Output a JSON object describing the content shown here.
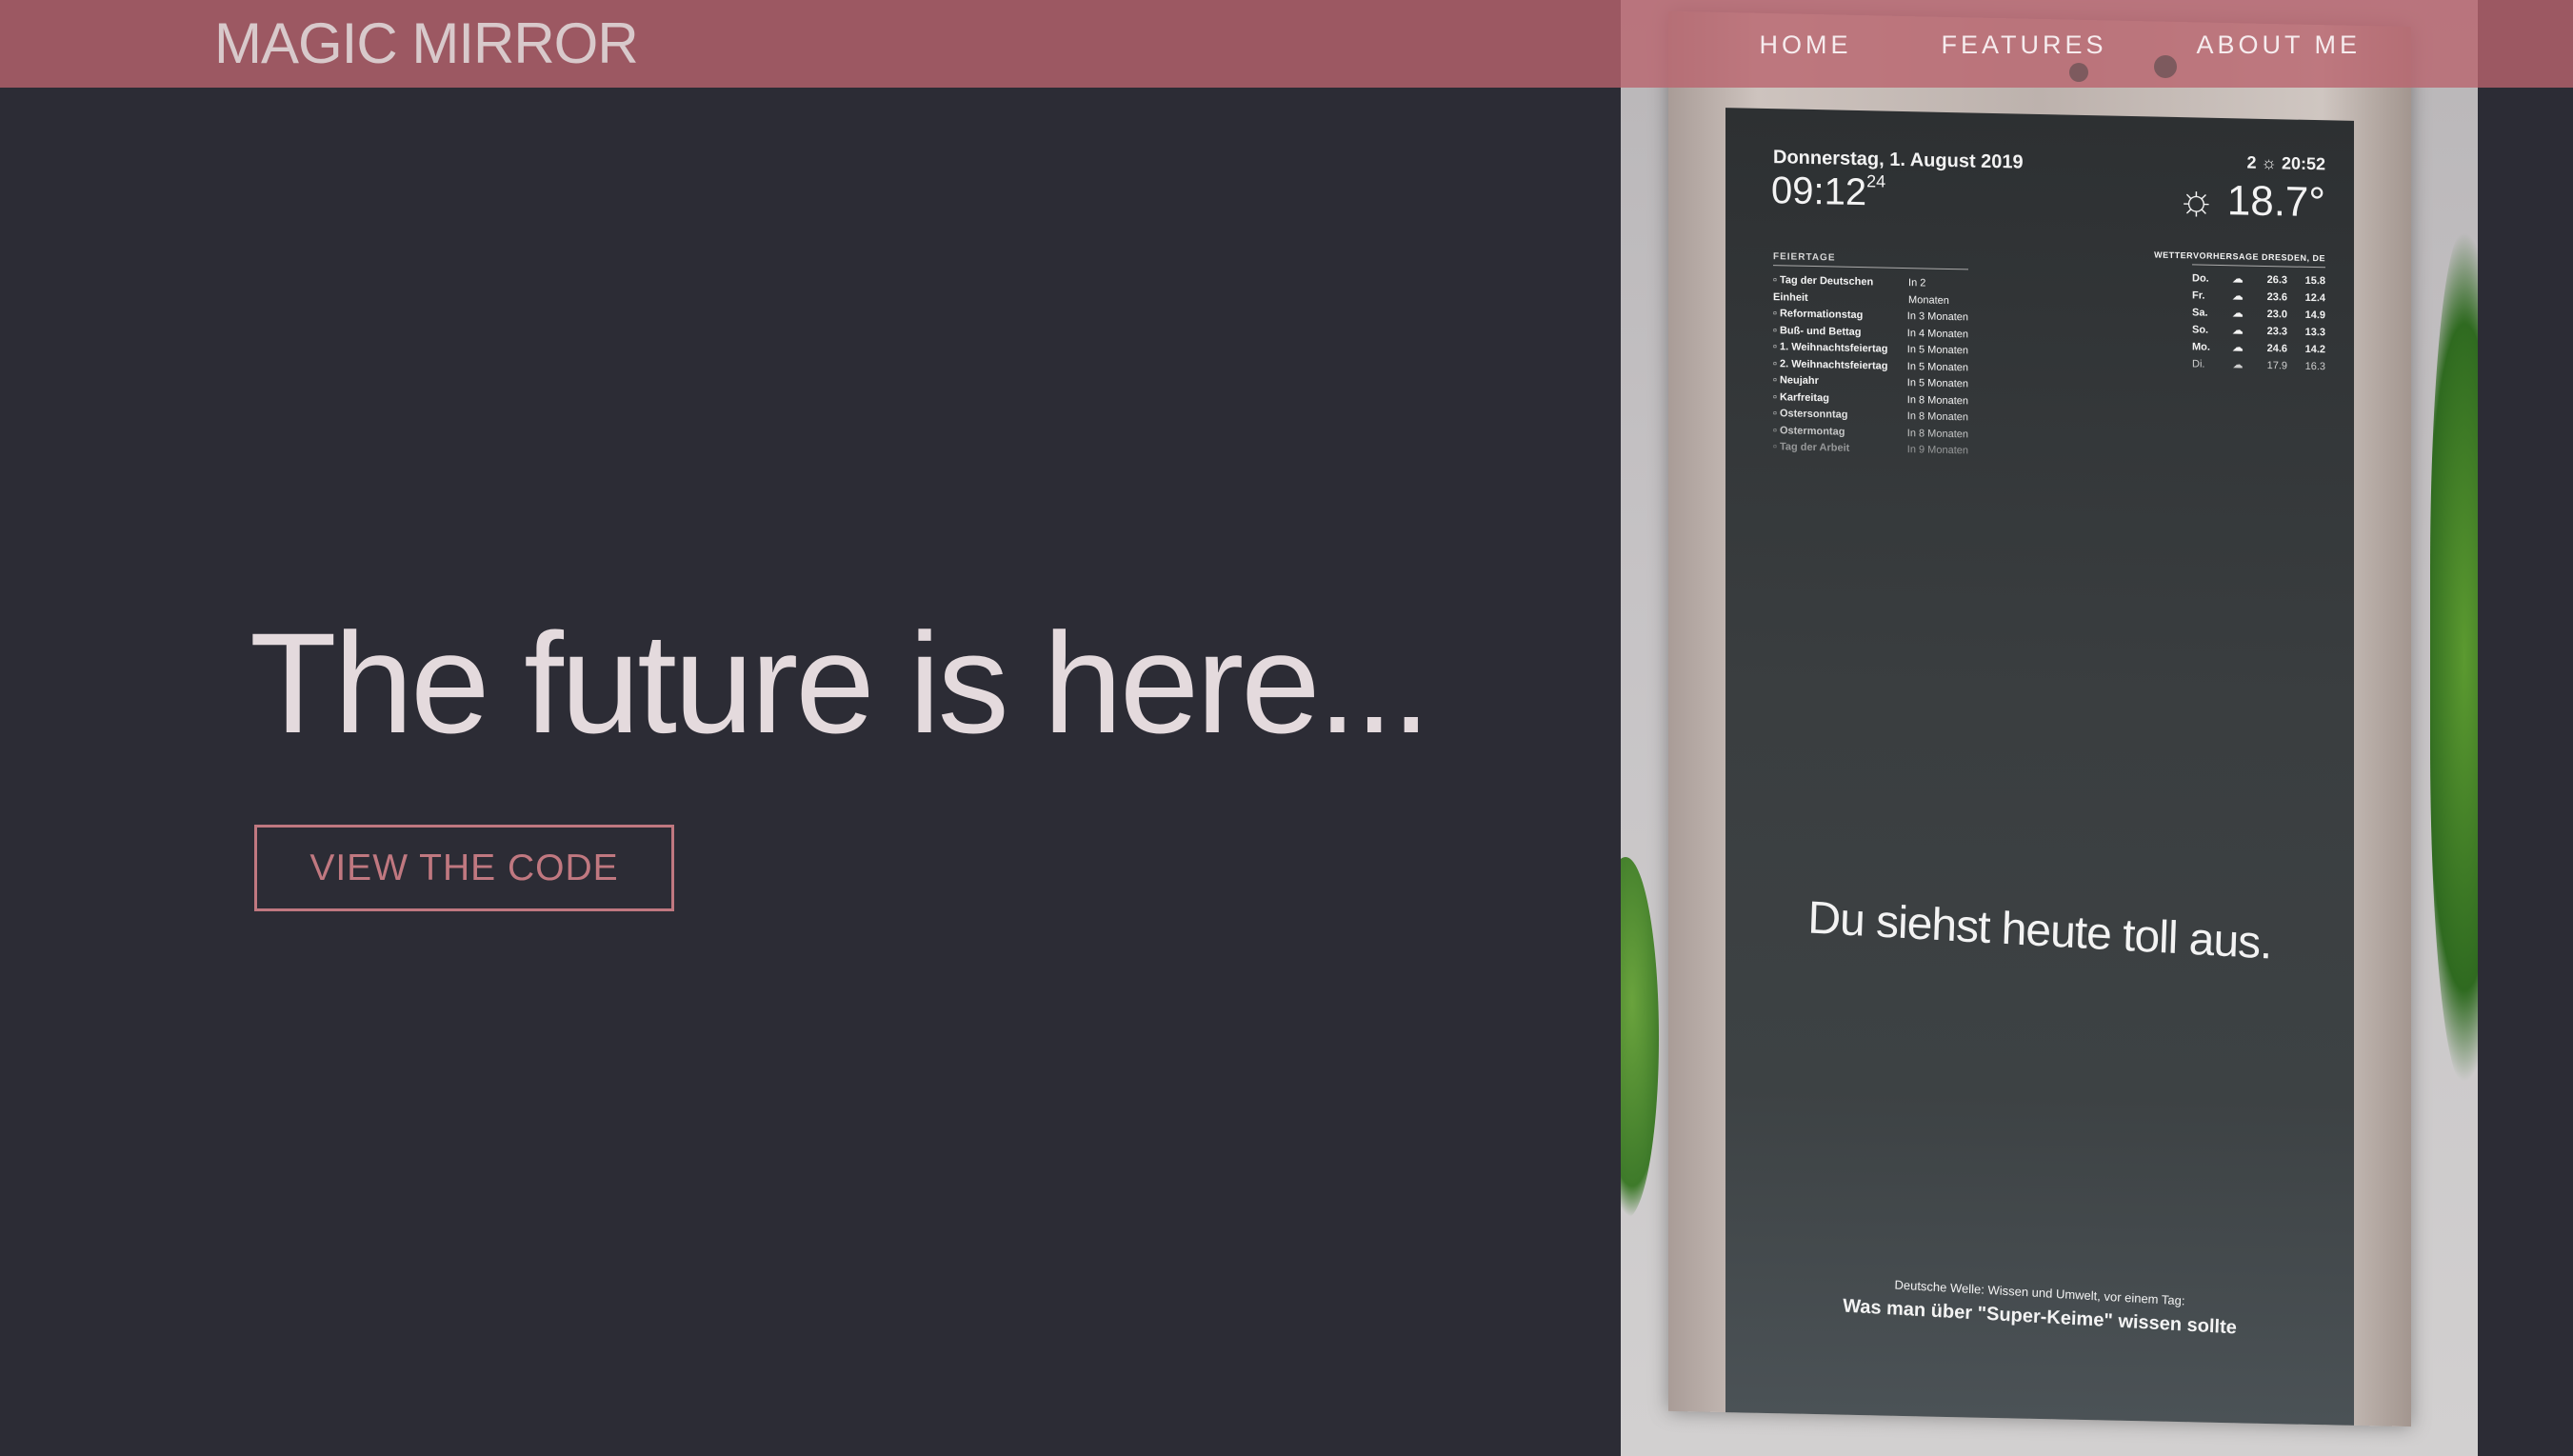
{
  "navbar": {
    "brand": "MAGIC MIRROR",
    "links": [
      "HOME",
      "FEATURES",
      "ABOUT ME"
    ]
  },
  "hero": {
    "title": "The future is here...",
    "cta_label": "VIEW THE CODE"
  },
  "mirror": {
    "date": "Donnerstag, 1. August 2019",
    "time": "09:12",
    "seconds": "24",
    "calendar_title": "FEIERTAGE",
    "calendar": [
      {
        "event": "Tag der Deutschen Einheit",
        "when": "In 2 Monaten"
      },
      {
        "event": "Reformationstag",
        "when": "In 3 Monaten"
      },
      {
        "event": "Buß- und Bettag",
        "when": "In 4 Monaten"
      },
      {
        "event": "1. Weihnachtsfeiertag",
        "when": "In 5 Monaten"
      },
      {
        "event": "2. Weihnachtsfeiertag",
        "when": "In 5 Monaten"
      },
      {
        "event": "Neujahr",
        "when": "In 5 Monaten"
      },
      {
        "event": "Karfreitag",
        "when": "In 8 Monaten"
      },
      {
        "event": "Ostersonntag",
        "when": "In 8 Monaten"
      },
      {
        "event": "Ostermontag",
        "when": "In 8 Monaten"
      },
      {
        "event": "Tag der Arbeit",
        "when": "In 9 Monaten"
      }
    ],
    "weather_top": "2 ☼ 20:52",
    "temperature": "☼ 18.7°",
    "forecast_title": "WETTERVORHERSAGE DRESDEN, DE",
    "forecast": [
      {
        "day": "Do.",
        "high": "26.3",
        "low": "15.8"
      },
      {
        "day": "Fr.",
        "high": "23.6",
        "low": "12.4"
      },
      {
        "day": "Sa.",
        "high": "23.0",
        "low": "14.9"
      },
      {
        "day": "So.",
        "high": "23.3",
        "low": "13.3"
      },
      {
        "day": "Mo.",
        "high": "24.6",
        "low": "14.2"
      },
      {
        "day": "Di.",
        "high": "17.9",
        "low": "16.3"
      }
    ],
    "compliment": "Du siehst heute toll aus.",
    "news_source": "Deutsche Welle: Wissen und Umwelt, vor einem Tag:",
    "news_title": "Was man über \"Super-Keime\" wissen sollte"
  },
  "colors": {
    "background": "#2c2c35",
    "navbar": "#b9646e",
    "accent": "#c07880"
  }
}
